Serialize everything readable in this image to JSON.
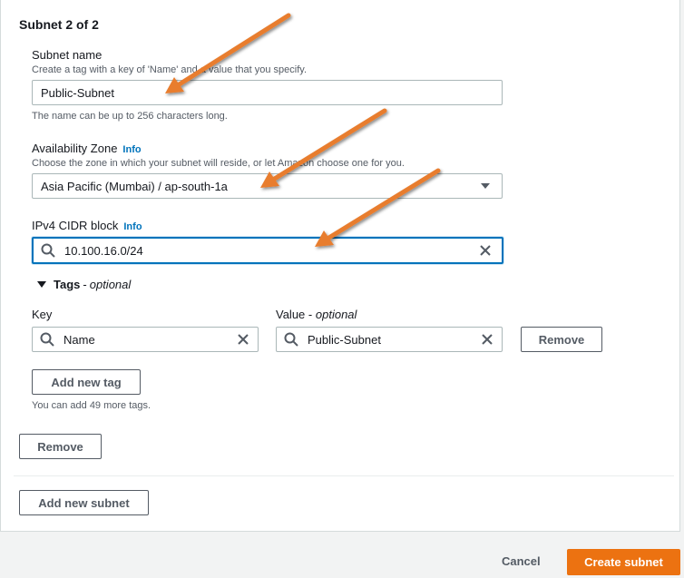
{
  "section": {
    "title": "Subnet 2 of 2"
  },
  "subnet_name": {
    "label": "Subnet name",
    "description": "Create a tag with a key of 'Name' and a value that you specify.",
    "value": "Public-Subnet",
    "hint": "The name can be up to 256 characters long."
  },
  "availability_zone": {
    "label": "Availability Zone",
    "info": "Info",
    "description": "Choose the zone in which your subnet will reside, or let Amazon choose one for you.",
    "value": "Asia Pacific (Mumbai) / ap-south-1a"
  },
  "cidr": {
    "label": "IPv4 CIDR block",
    "info": "Info",
    "value": "10.100.16.0/24"
  },
  "tags": {
    "toggle_label": "Tags",
    "toggle_optional": "optional",
    "key_header": "Key",
    "value_header": "Value",
    "value_optional": "optional",
    "key_value": "Name",
    "value_value": "Public-Subnet",
    "remove_label": "Remove",
    "add_label": "Add new tag",
    "remaining": "You can add 49 more tags."
  },
  "remove_subnet_label": "Remove",
  "add_subnet_label": "Add new subnet",
  "footer": {
    "cancel_label": "Cancel",
    "create_label": "Create subnet"
  },
  "colors": {
    "accent": "#ec7211",
    "link": "#0073bb",
    "focus": "#0073bb",
    "annotation_arrow": "#e87d2e"
  },
  "icons": [
    "search-icon",
    "clear-icon",
    "caret-down-icon",
    "caret-expanded-icon",
    "annotation-arrow"
  ]
}
